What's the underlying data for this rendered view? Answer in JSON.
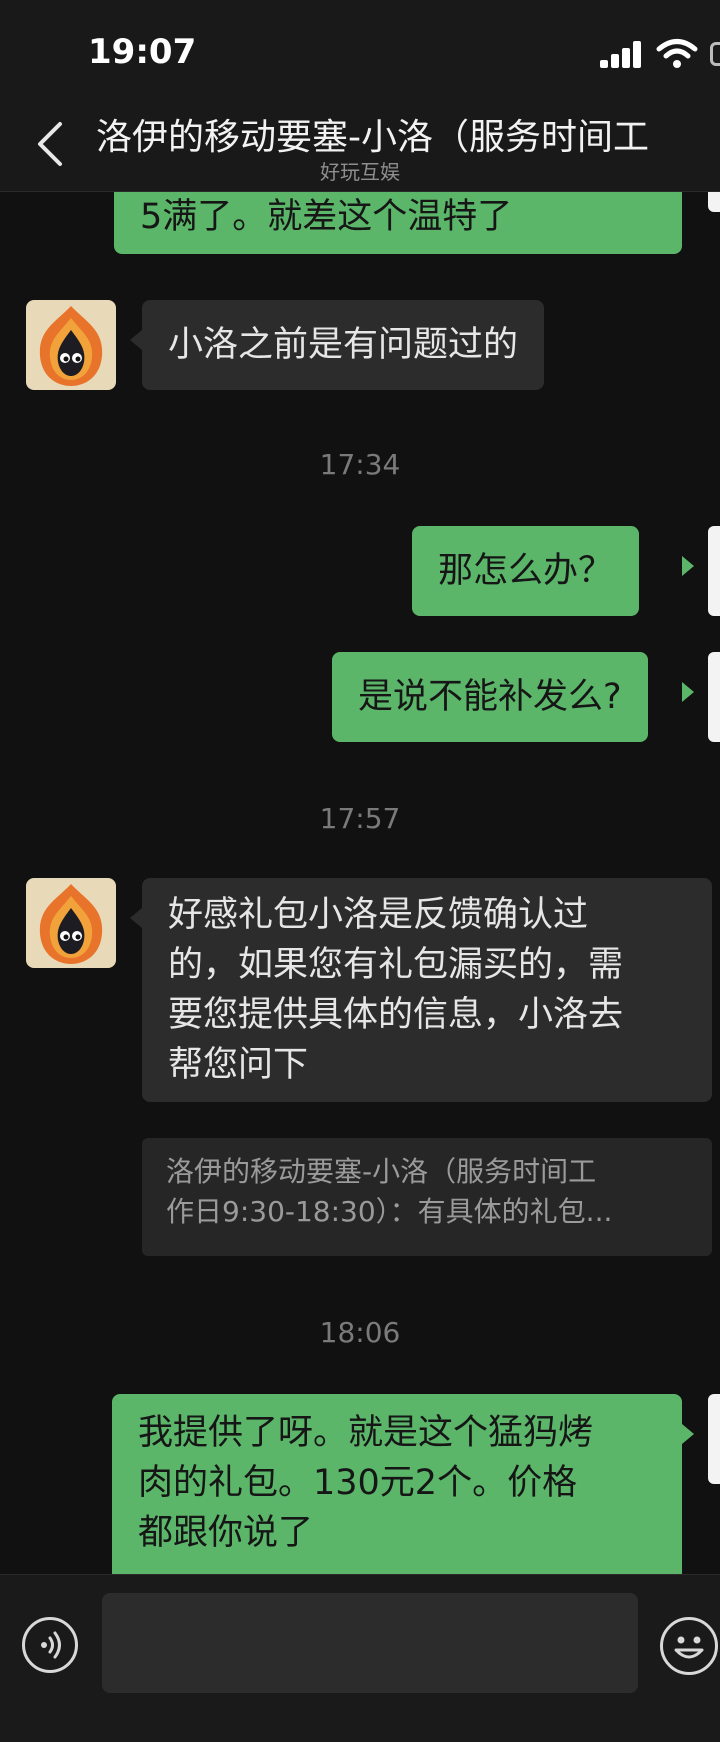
{
  "status_bar": {
    "time": "19:07"
  },
  "header": {
    "title": "洛伊的移动要塞-小洛（服务时间工",
    "subtitle": "好玩互娱"
  },
  "messages": {
    "m1_line1": "5满了。就差这个温特了",
    "m2_line1": "小洛之前是有问题过的",
    "time1": "17:34",
    "m3_line1": "那怎么办？",
    "m4_line1": "是说不能补发么?",
    "time2": "17:57",
    "m5_line1": "好感礼包小洛是反馈确认过",
    "m5_line2": "的，如果您有礼包漏买的，需",
    "m5_line3": "要您提供具体的信息，小洛去",
    "m5_line4": "帮您问下",
    "quote_line1": "洛伊的移动要塞-小洛（服务时间工",
    "quote_line2": "作日9:30-18:30）：有具体的礼包...",
    "time3": "18:06",
    "m6_line1": "我提供了呀。就是这个猛犸烤",
    "m6_line2": "肉的礼包。130元2个。价格",
    "m6_line3": "都跟你说了"
  },
  "input": {
    "value": ""
  },
  "colors": {
    "my_bubble": "#5bb66a",
    "other_bubble": "#2c2c2c",
    "background": "#111111"
  }
}
